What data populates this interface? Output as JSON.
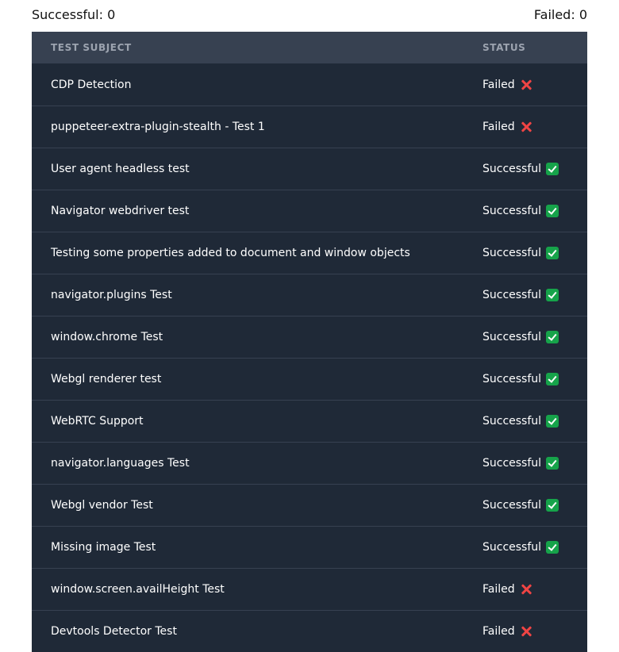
{
  "summary": {
    "successful_label": "Successful: 0",
    "failed_label": "Failed: 0"
  },
  "table": {
    "headers": {
      "subject": "TEST SUBJECT",
      "status": "STATUS"
    },
    "rows": [
      {
        "subject": "CDP Detection",
        "status": "Failed",
        "icon": "cross-mark-icon"
      },
      {
        "subject": "puppeteer-extra-plugin-stealth - Test 1",
        "status": "Failed",
        "icon": "cross-mark-icon"
      },
      {
        "subject": "User agent headless test",
        "status": "Successful",
        "icon": "check-mark-icon"
      },
      {
        "subject": "Navigator webdriver test",
        "status": "Successful",
        "icon": "check-mark-icon"
      },
      {
        "subject": "Testing some properties added to document and window objects",
        "status": "Successful",
        "icon": "check-mark-icon"
      },
      {
        "subject": "navigator.plugins Test",
        "status": "Successful",
        "icon": "check-mark-icon"
      },
      {
        "subject": "window.chrome Test",
        "status": "Successful",
        "icon": "check-mark-icon"
      },
      {
        "subject": "Webgl renderer test",
        "status": "Successful",
        "icon": "check-mark-icon"
      },
      {
        "subject": "WebRTC Support",
        "status": "Successful",
        "icon": "check-mark-icon"
      },
      {
        "subject": "navigator.languages Test",
        "status": "Successful",
        "icon": "check-mark-icon"
      },
      {
        "subject": "Webgl vendor Test",
        "status": "Successful",
        "icon": "check-mark-icon"
      },
      {
        "subject": "Missing image Test",
        "status": "Successful",
        "icon": "check-mark-icon"
      },
      {
        "subject": "window.screen.availHeight Test",
        "status": "Failed",
        "icon": "cross-mark-icon"
      },
      {
        "subject": "Devtools Detector Test",
        "status": "Failed",
        "icon": "cross-mark-icon"
      }
    ]
  },
  "colors": {
    "table_bg": "#1f2937",
    "header_bg": "#374151",
    "success": "#16a34a",
    "fail": "#ef4444"
  }
}
